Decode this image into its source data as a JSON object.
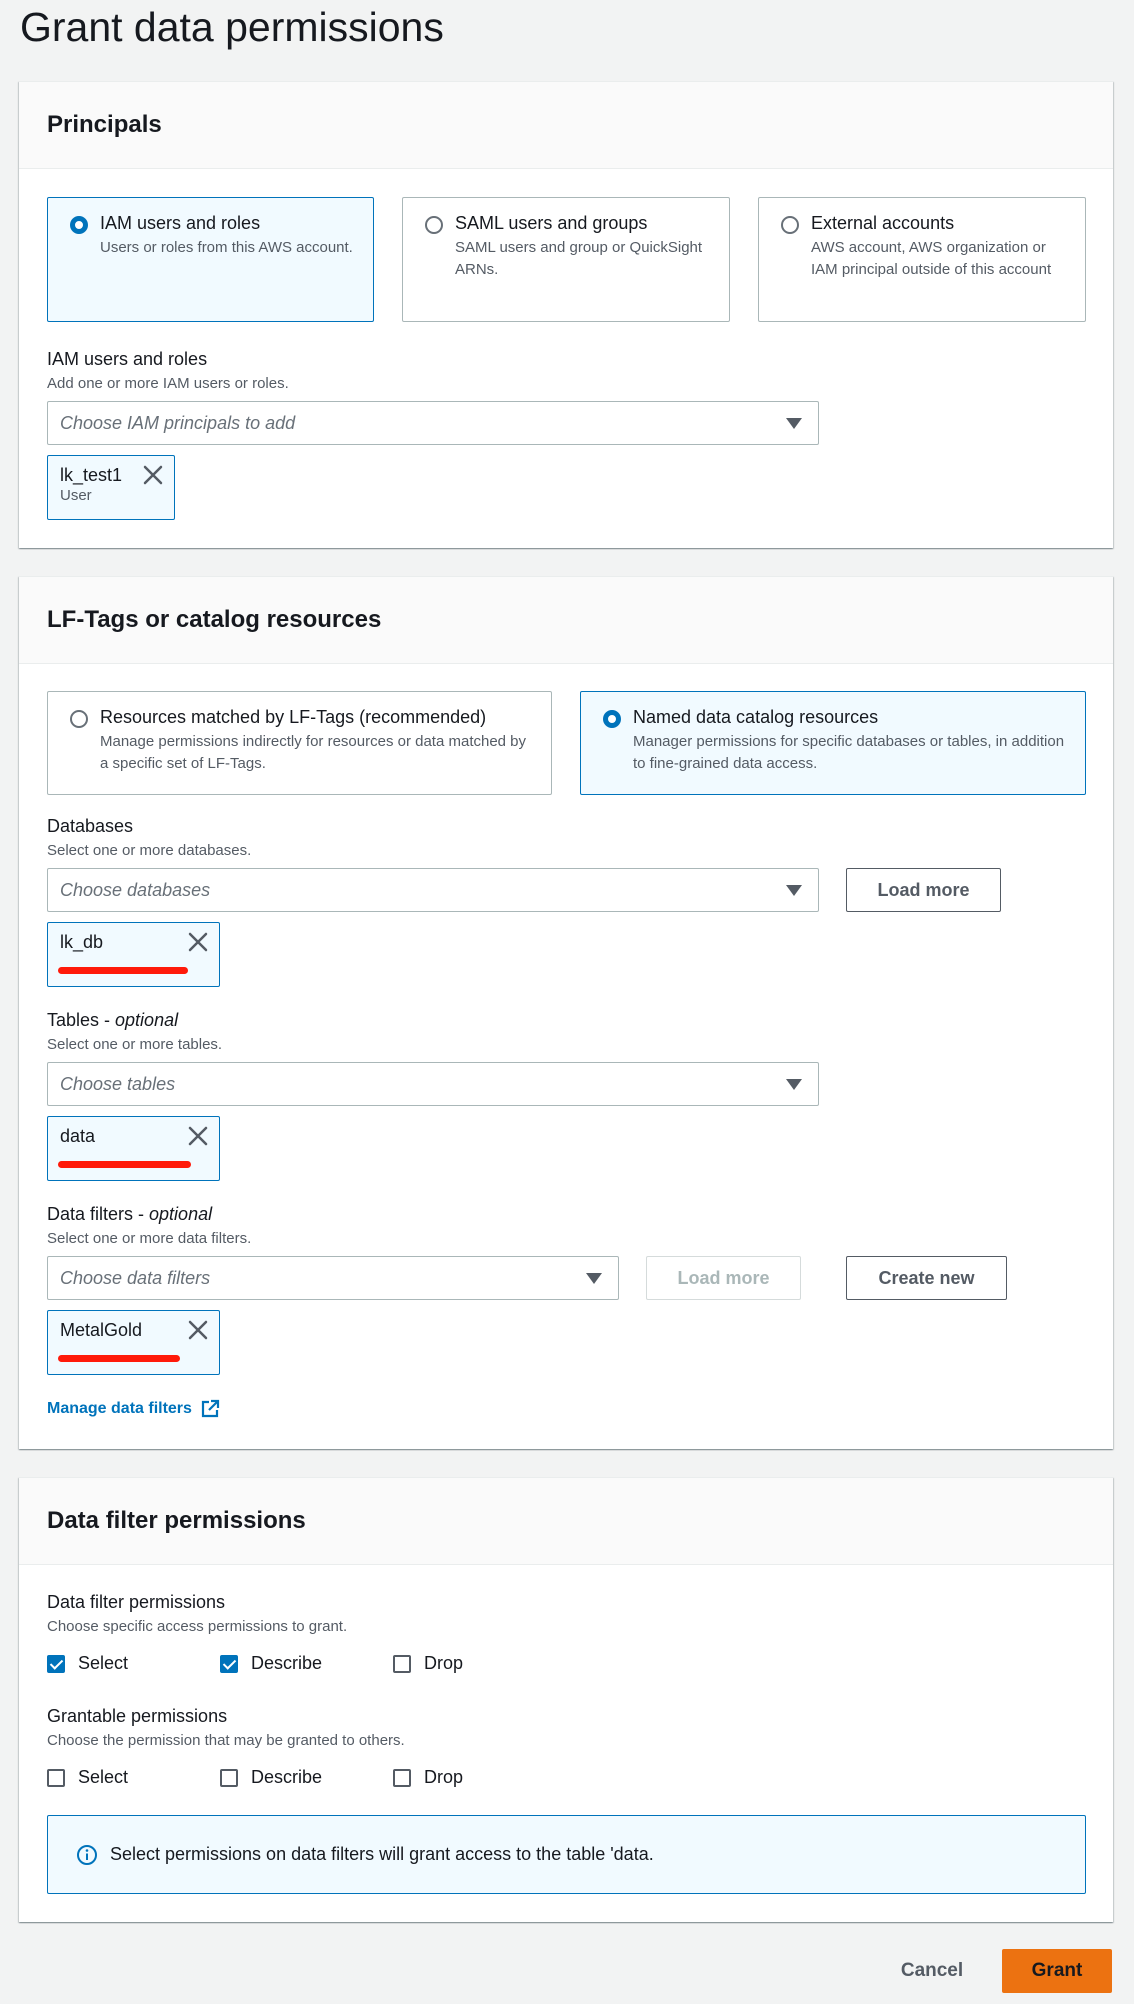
{
  "page": {
    "title": "Grant data permissions"
  },
  "principals": {
    "header": "Principals",
    "options": [
      {
        "title": "IAM users and roles",
        "desc": "Users or roles from this AWS account.",
        "selected": true
      },
      {
        "title": "SAML users and groups",
        "desc": "SAML users and group or QuickSight ARNs.",
        "selected": false
      },
      {
        "title": "External accounts",
        "desc": "AWS account, AWS organization or IAM principal outside of this account",
        "selected": false
      }
    ],
    "iam_field": {
      "label": "IAM users and roles",
      "desc": "Add one or more IAM users or roles.",
      "placeholder": "Choose IAM principals to add",
      "token": {
        "name": "lk_test1",
        "sub": "User"
      }
    }
  },
  "resources": {
    "header": "LF-Tags or catalog resources",
    "options": [
      {
        "title": "Resources matched by LF-Tags (recommended)",
        "desc": "Manage permissions indirectly for resources or data matched by a specific set of LF-Tags.",
        "selected": false
      },
      {
        "title": "Named data catalog resources",
        "desc": "Manager permissions for specific databases or tables, in addition to fine-grained data access.",
        "selected": true
      }
    ],
    "databases": {
      "label": "Databases",
      "desc": "Select one or more databases.",
      "placeholder": "Choose databases",
      "load_more": "Load more",
      "token": {
        "name": "lk_db"
      }
    },
    "tables": {
      "label": "Tables",
      "label_suffix": " - ",
      "optional": "optional",
      "desc": "Select one or more tables.",
      "placeholder": "Choose tables",
      "token": {
        "name": "data"
      }
    },
    "filters": {
      "label": "Data filters",
      "label_suffix": " - ",
      "optional": "optional",
      "desc": "Select one or more data filters.",
      "placeholder": "Choose data filters",
      "load_more": "Load more",
      "create_new": "Create new",
      "token": {
        "name": "MetalGold"
      },
      "manage_link": "Manage data filters"
    }
  },
  "filter_permissions": {
    "header": "Data filter permissions",
    "perms": {
      "label": "Data filter permissions",
      "desc": "Choose specific access permissions to grant.",
      "items": [
        {
          "label": "Select",
          "checked": true
        },
        {
          "label": "Describe",
          "checked": true
        },
        {
          "label": "Drop",
          "checked": false
        }
      ]
    },
    "grantable": {
      "label": "Grantable permissions",
      "desc": "Choose the permission that may be granted to others.",
      "items": [
        {
          "label": "Select",
          "checked": false
        },
        {
          "label": "Describe",
          "checked": false
        },
        {
          "label": "Drop",
          "checked": false
        }
      ]
    },
    "info": "Select permissions on data filters will grant access to the table 'data."
  },
  "footer": {
    "cancel": "Cancel",
    "grant": "Grant"
  },
  "colors": {
    "accent": "#0073bb",
    "primary_button": "#ec7211",
    "redaction": "#ff1a0a"
  }
}
